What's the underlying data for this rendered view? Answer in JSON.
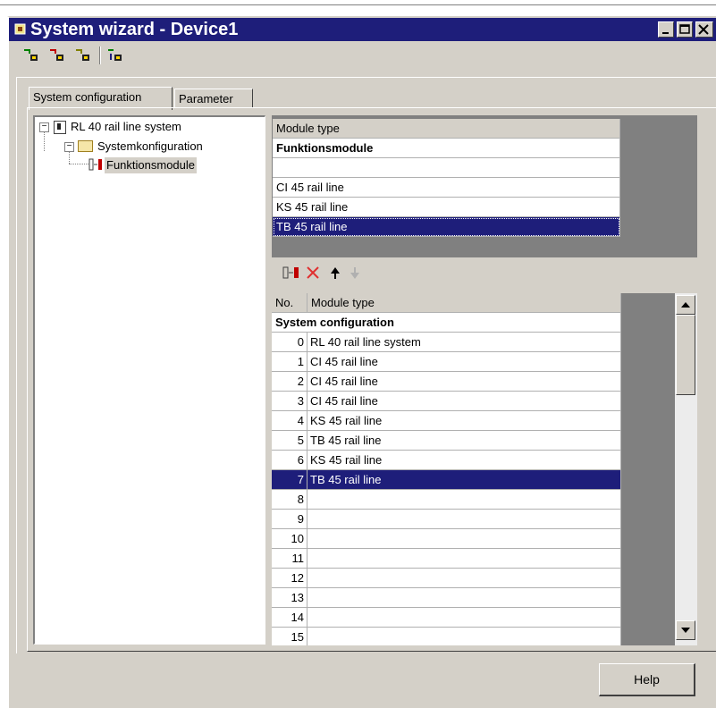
{
  "window": {
    "title": "System wizard - Device1",
    "controls": {
      "minimize": "_",
      "maximize": "□",
      "close": "X"
    }
  },
  "toolbar": {
    "buttons": [
      "module-add-icon",
      "module-remove-icon",
      "module-swap-icon",
      "module-info-icon"
    ]
  },
  "tabs": [
    {
      "label": "System configuration",
      "active": true
    },
    {
      "label": "Parameter",
      "active": false
    }
  ],
  "tree": {
    "root": {
      "label": "RL 40 rail line system",
      "expander": "−"
    },
    "child": {
      "label": "Systemkonfiguration",
      "expander": "−"
    },
    "leaf": {
      "label": "Funktionsmodule",
      "selected": true
    }
  },
  "module_list": {
    "header": "Module type",
    "group": "Funktionsmodule",
    "items": [
      "",
      "CI 45 rail line",
      "KS 45 rail line",
      "TB 45 rail line"
    ],
    "selected_index": 3
  },
  "config_toolbar": {
    "buttons": [
      "insert-module-icon",
      "delete-icon",
      "move-up-icon",
      "move-down-icon"
    ]
  },
  "config_table": {
    "headers": [
      "No.",
      "Module type"
    ],
    "group": "System configuration",
    "rows": [
      {
        "no": "0",
        "type": "RL 40 rail line system"
      },
      {
        "no": "1",
        "type": "CI 45 rail line"
      },
      {
        "no": "2",
        "type": "CI 45 rail line"
      },
      {
        "no": "3",
        "type": "CI 45 rail line"
      },
      {
        "no": "4",
        "type": "KS 45 rail line"
      },
      {
        "no": "5",
        "type": "TB 45 rail line"
      },
      {
        "no": "6",
        "type": "KS 45 rail line"
      },
      {
        "no": "7",
        "type": "TB 45 rail line"
      },
      {
        "no": "8",
        "type": ""
      },
      {
        "no": "9",
        "type": ""
      },
      {
        "no": "10",
        "type": ""
      },
      {
        "no": "11",
        "type": ""
      },
      {
        "no": "12",
        "type": ""
      },
      {
        "no": "13",
        "type": ""
      },
      {
        "no": "14",
        "type": ""
      },
      {
        "no": "15",
        "type": ""
      }
    ],
    "selected_index": 7
  },
  "footer": {
    "help_label": "Help"
  },
  "colors": {
    "title_bar": "#1e1e7a",
    "selection": "#1e1e7a",
    "face": "#d4d0c8"
  }
}
